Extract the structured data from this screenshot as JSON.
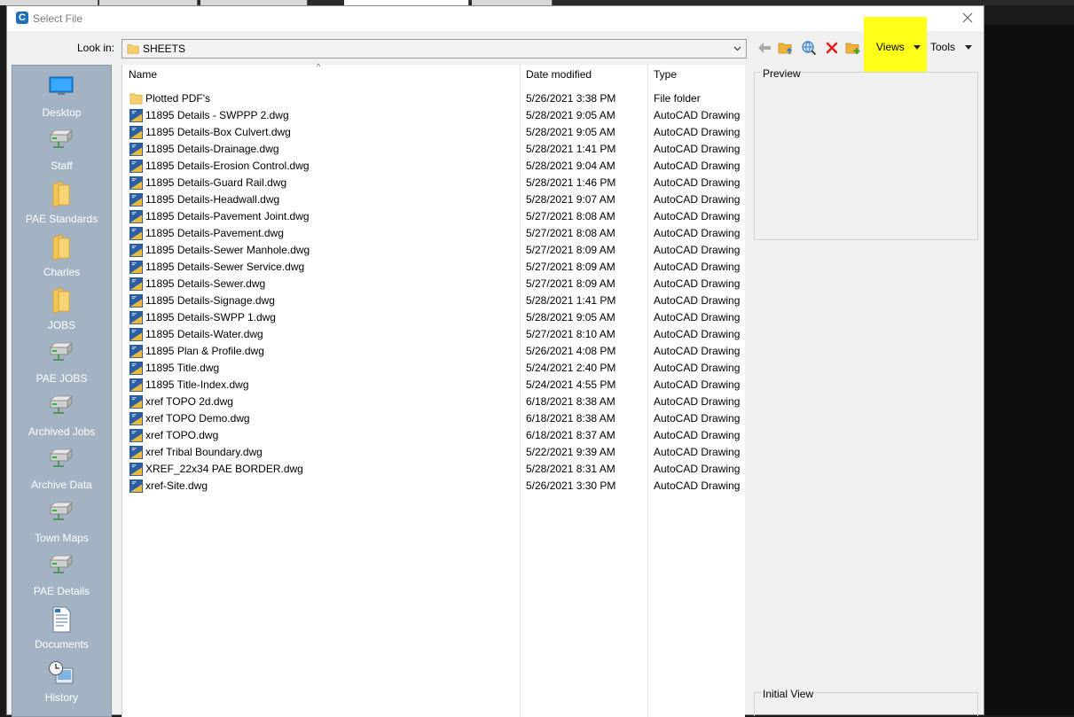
{
  "window": {
    "title": "Select File",
    "close_icon": "close-icon"
  },
  "toolbar": {
    "look_in_label": "Look in:",
    "look_in_value": "SHEETS",
    "views_label": "Views",
    "tools_label": "Tools",
    "highlight_color": "#ffff1a"
  },
  "places": [
    {
      "label": "Desktop",
      "icon": "desktop-icon"
    },
    {
      "label": "Staff",
      "icon": "network-drive-icon"
    },
    {
      "label": "PAE Standards",
      "icon": "folder-icon"
    },
    {
      "label": "Charles",
      "icon": "folder-icon"
    },
    {
      "label": "JOBS",
      "icon": "folder-icon"
    },
    {
      "label": "PAE JOBS",
      "icon": "network-drive-icon"
    },
    {
      "label": "Archived Jobs",
      "icon": "network-drive-icon"
    },
    {
      "label": "Archive Data",
      "icon": "network-drive-icon"
    },
    {
      "label": "Town Maps",
      "icon": "network-drive-icon"
    },
    {
      "label": "PAE Details",
      "icon": "network-drive-icon"
    },
    {
      "label": "Documents",
      "icon": "documents-icon"
    },
    {
      "label": "History",
      "icon": "history-icon"
    }
  ],
  "columns": {
    "name": "Name",
    "date": "Date modified",
    "type": "Type"
  },
  "files": [
    {
      "name": "Plotted PDF's",
      "date": "5/26/2021 3:38 PM",
      "type": "File folder",
      "kind": "folder"
    },
    {
      "name": "11895 Details - SWPPP 2.dwg",
      "date": "5/28/2021 9:05 AM",
      "type": "AutoCAD Drawing",
      "kind": "dwg"
    },
    {
      "name": "11895 Details-Box Culvert.dwg",
      "date": "5/28/2021 9:05 AM",
      "type": "AutoCAD Drawing",
      "kind": "dwg"
    },
    {
      "name": "11895 Details-Drainage.dwg",
      "date": "5/28/2021 1:41 PM",
      "type": "AutoCAD Drawing",
      "kind": "dwg"
    },
    {
      "name": "11895 Details-Erosion Control.dwg",
      "date": "5/28/2021 9:04 AM",
      "type": "AutoCAD Drawing",
      "kind": "dwg"
    },
    {
      "name": "11895 Details-Guard Rail.dwg",
      "date": "5/28/2021 1:46 PM",
      "type": "AutoCAD Drawing",
      "kind": "dwg"
    },
    {
      "name": "11895 Details-Headwall.dwg",
      "date": "5/28/2021 9:07 AM",
      "type": "AutoCAD Drawing",
      "kind": "dwg"
    },
    {
      "name": "11895 Details-Pavement Joint.dwg",
      "date": "5/27/2021 8:08 AM",
      "type": "AutoCAD Drawing",
      "kind": "dwg"
    },
    {
      "name": "11895 Details-Pavement.dwg",
      "date": "5/27/2021 8:08 AM",
      "type": "AutoCAD Drawing",
      "kind": "dwg"
    },
    {
      "name": "11895 Details-Sewer Manhole.dwg",
      "date": "5/27/2021 8:09 AM",
      "type": "AutoCAD Drawing",
      "kind": "dwg"
    },
    {
      "name": "11895 Details-Sewer Service.dwg",
      "date": "5/27/2021 8:09 AM",
      "type": "AutoCAD Drawing",
      "kind": "dwg"
    },
    {
      "name": "11895 Details-Sewer.dwg",
      "date": "5/27/2021 8:09 AM",
      "type": "AutoCAD Drawing",
      "kind": "dwg"
    },
    {
      "name": "11895 Details-Signage.dwg",
      "date": "5/28/2021 1:41 PM",
      "type": "AutoCAD Drawing",
      "kind": "dwg"
    },
    {
      "name": "11895 Details-SWPP 1.dwg",
      "date": "5/28/2021 9:05 AM",
      "type": "AutoCAD Drawing",
      "kind": "dwg"
    },
    {
      "name": "11895 Details-Water.dwg",
      "date": "5/27/2021 8:10 AM",
      "type": "AutoCAD Drawing",
      "kind": "dwg"
    },
    {
      "name": "11895 Plan & Profile.dwg",
      "date": "5/26/2021 4:08 PM",
      "type": "AutoCAD Drawing",
      "kind": "dwg"
    },
    {
      "name": "11895 Title.dwg",
      "date": "5/24/2021 2:40 PM",
      "type": "AutoCAD Drawing",
      "kind": "dwg"
    },
    {
      "name": "11895 Title-Index.dwg",
      "date": "5/24/2021 4:55 PM",
      "type": "AutoCAD Drawing",
      "kind": "dwg"
    },
    {
      "name": "xref TOPO 2d.dwg",
      "date": "6/18/2021 8:38 AM",
      "type": "AutoCAD Drawing",
      "kind": "dwg"
    },
    {
      "name": "xref TOPO Demo.dwg",
      "date": "6/18/2021 8:38 AM",
      "type": "AutoCAD Drawing",
      "kind": "dwg"
    },
    {
      "name": "xref TOPO.dwg",
      "date": "6/18/2021 8:37 AM",
      "type": "AutoCAD Drawing",
      "kind": "dwg"
    },
    {
      "name": "xref Tribal Boundary.dwg",
      "date": "5/22/2021 9:39 AM",
      "type": "AutoCAD Drawing",
      "kind": "dwg"
    },
    {
      "name": "XREF_22x34 PAE BORDER.dwg",
      "date": "5/28/2021 8:31 AM",
      "type": "AutoCAD Drawing",
      "kind": "dwg"
    },
    {
      "name": "xref-Site.dwg",
      "date": "5/26/2021 3:30 PM",
      "type": "AutoCAD Drawing",
      "kind": "dwg"
    }
  ],
  "preview": {
    "label": "Preview",
    "initial_view_label": "Initial View"
  }
}
